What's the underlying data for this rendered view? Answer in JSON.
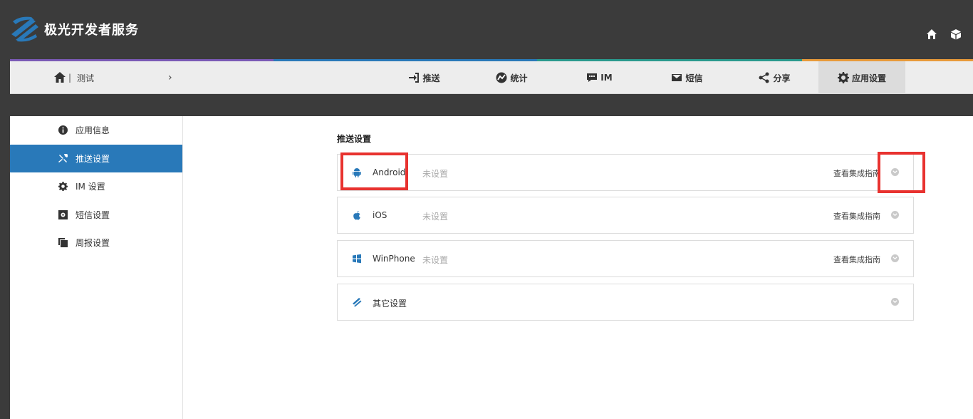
{
  "header": {
    "logo_text": "极光开发者服务",
    "icons": [
      "home-icon",
      "cube-icon"
    ]
  },
  "strip_colors": [
    "#7b5ab6",
    "#2979b9",
    "#2a9a8e",
    "#e89a3a"
  ],
  "breadcrumb": {
    "current": "测试",
    "arrow": "›"
  },
  "tabs": [
    {
      "label": "推送",
      "icon": "push-icon",
      "active": false
    },
    {
      "label": "统计",
      "icon": "stats-icon",
      "active": false
    },
    {
      "label": "IM",
      "icon": "chat-icon",
      "active": false
    },
    {
      "label": "短信",
      "icon": "sms-icon",
      "active": false
    },
    {
      "label": "分享",
      "icon": "share-icon",
      "active": false
    },
    {
      "label": "应用设置",
      "icon": "gear-icon",
      "active": true
    }
  ],
  "sidebar": {
    "items": [
      {
        "label": "应用信息",
        "icon": "info-icon",
        "active": false
      },
      {
        "label": "推送设置",
        "icon": "tools-icon",
        "active": true
      },
      {
        "label": "IM 设置",
        "icon": "cog-icon",
        "active": false
      },
      {
        "label": "短信设置",
        "icon": "sms-settings-icon",
        "active": false
      },
      {
        "label": "周报设置",
        "icon": "report-icon",
        "active": false
      }
    ]
  },
  "main": {
    "section_title": "推送设置",
    "panels": [
      {
        "name": "Android",
        "status": "未设置",
        "link": "查看集成指南",
        "icon": "android-icon"
      },
      {
        "name": "iOS",
        "status": "未设置",
        "link": "查看集成指南",
        "icon": "apple-icon"
      },
      {
        "name": "WinPhone",
        "status": "未设置",
        "link": "查看集成指南",
        "icon": "windows-icon"
      },
      {
        "name": "其它设置",
        "status": "",
        "link": "",
        "icon": "jiguang-icon"
      }
    ]
  },
  "colors": {
    "accent": "#2979b9",
    "header_bg": "#3b3b3b",
    "highlight": "#e8322f"
  }
}
